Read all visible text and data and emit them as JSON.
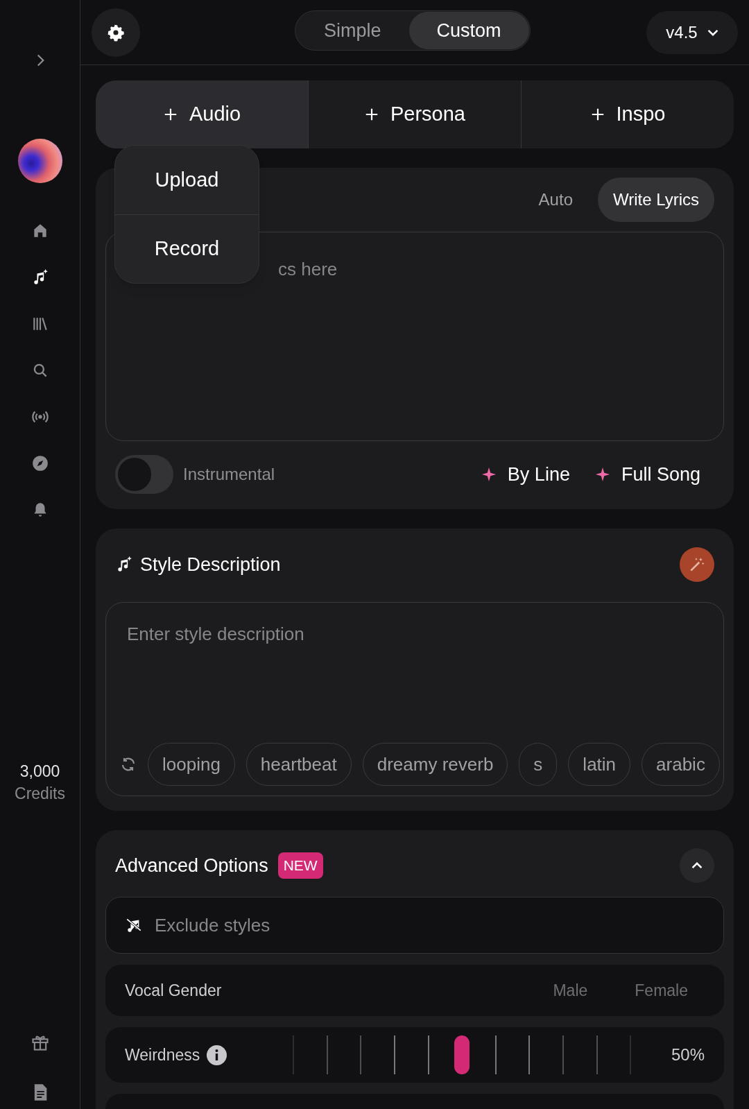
{
  "sidebar": {
    "nav": [
      {
        "selected": false
      },
      {
        "selected": true
      },
      {
        "selected": false
      },
      {
        "selected": false
      },
      {
        "selected": false
      },
      {
        "selected": false
      },
      {
        "selected": false
      }
    ],
    "credits": {
      "amount": "3,000",
      "label": "Credits"
    }
  },
  "mode_tabs": [
    {
      "label": "Simple",
      "selected": false
    },
    {
      "label": "Custom",
      "selected": true
    }
  ],
  "version": "v4.5",
  "add_buttons": [
    {
      "label": "Audio",
      "expanded": true
    },
    {
      "label": "Persona",
      "expanded": false
    },
    {
      "label": "Inspo",
      "expanded": false
    }
  ],
  "dropdown": [
    "Upload",
    "Record"
  ],
  "lyrics": {
    "modes": [
      {
        "label": "Auto",
        "selected": false
      },
      {
        "label": "Write Lyrics",
        "selected": true
      }
    ],
    "placeholder": "cs here",
    "instrumental": {
      "label": "Instrumental",
      "on": false
    },
    "actions": [
      "By Line",
      "Full Song"
    ]
  },
  "style": {
    "title": "Style Description",
    "placeholder": "Enter style description",
    "tags": [
      "looping",
      "heartbeat",
      "dreamy reverb",
      "s",
      "latin",
      "arabic"
    ]
  },
  "advanced": {
    "title": "Advanced Options",
    "badge": "NEW",
    "expanded": true,
    "exclude_placeholder": "Exclude styles",
    "vocal_gender": {
      "label": "Vocal Gender",
      "options": [
        {
          "label": "Male",
          "selected": false
        },
        {
          "label": "Female",
          "selected": false
        }
      ]
    },
    "weirdness": {
      "label": "Weirdness",
      "level": 0.5,
      "reading": "50%"
    }
  }
}
